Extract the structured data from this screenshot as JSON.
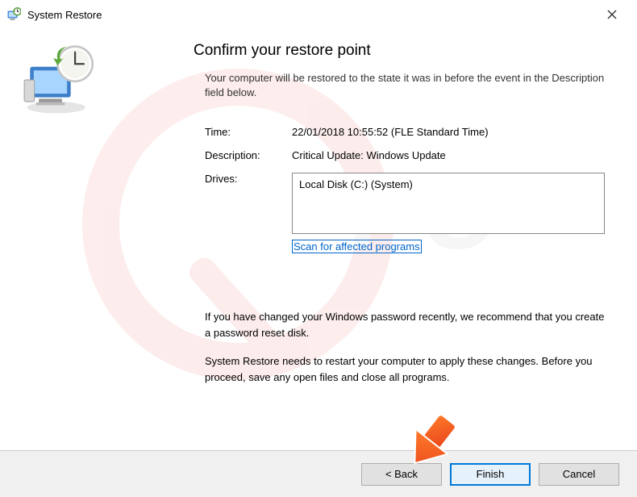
{
  "titlebar": {
    "title": "System Restore"
  },
  "main": {
    "heading": "Confirm your restore point",
    "intro": "Your computer will be restored to the state it was in before the event in the Description field below.",
    "time_label": "Time:",
    "time_value": "22/01/2018 10:55:52 (FLE Standard Time)",
    "description_label": "Description:",
    "description_value": "Critical Update: Windows Update",
    "drives_label": "Drives:",
    "drives_value": "Local Disk (C:) (System)",
    "scan_link": "Scan for affected programs",
    "warn1": "If you have changed your Windows password recently, we recommend that you create a password reset disk.",
    "warn2": "System Restore needs to restart your computer to apply these changes. Before you proceed, save any open files and close all programs."
  },
  "footer": {
    "back": "< Back",
    "finish": "Finish",
    "cancel": "Cancel"
  }
}
